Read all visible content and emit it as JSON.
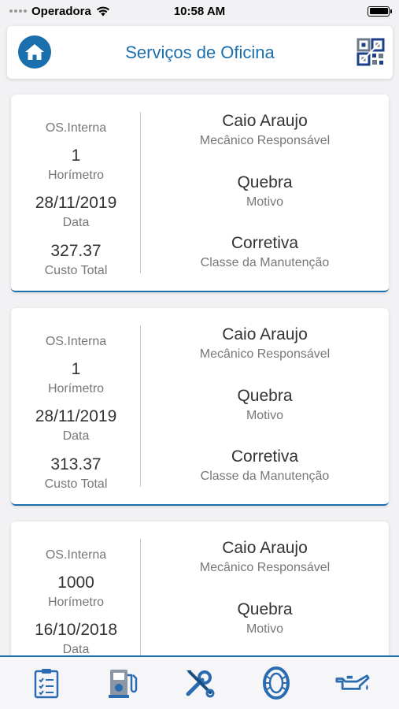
{
  "status_bar": {
    "carrier": "Operadora",
    "time": "10:58 AM"
  },
  "header": {
    "title": "Serviços de Oficina",
    "home_icon": "home-icon",
    "qr_icon": "qr-code-icon"
  },
  "colors": {
    "accent": "#1c6fad",
    "background": "#f2f2f4",
    "card": "#ffffff"
  },
  "cards": [
    {
      "os_label": "OS.Interna",
      "horimetro_value": "1",
      "horimetro_label": "Horímetro",
      "date_value": "28/11/2019",
      "date_label": "Data",
      "cost_value": "327.37",
      "cost_label": "Custo Total",
      "mechanic_value": "Caio Araujo",
      "mechanic_label": "Mecânico Responsável",
      "reason_value": "Quebra",
      "reason_label": "Motivo",
      "class_value": "Corretiva",
      "class_label": "Classe da Manutenção"
    },
    {
      "os_label": "OS.Interna",
      "horimetro_value": "1",
      "horimetro_label": "Horímetro",
      "date_value": "28/11/2019",
      "date_label": "Data",
      "cost_value": "313.37",
      "cost_label": "Custo Total",
      "mechanic_value": "Caio Araujo",
      "mechanic_label": "Mecânico Responsável",
      "reason_value": "Quebra",
      "reason_label": "Motivo",
      "class_value": "Corretiva",
      "class_label": "Classe da Manutenção"
    },
    {
      "os_label": "OS.Interna",
      "horimetro_value": "1000",
      "horimetro_label": "Horímetro",
      "date_value": "16/10/2018",
      "date_label": "Data",
      "cost_value": "",
      "cost_label": "",
      "mechanic_value": "Caio Araujo",
      "mechanic_label": "Mecânico Responsável",
      "reason_value": "Quebra",
      "reason_label": "Motivo",
      "class_value": "",
      "class_label": ""
    }
  ],
  "tab_bar": {
    "items": [
      {
        "icon": "checklist-icon"
      },
      {
        "icon": "fuel-pump-icon"
      },
      {
        "icon": "wrench-screwdriver-icon"
      },
      {
        "icon": "tire-icon"
      },
      {
        "icon": "oil-can-icon"
      }
    ]
  }
}
